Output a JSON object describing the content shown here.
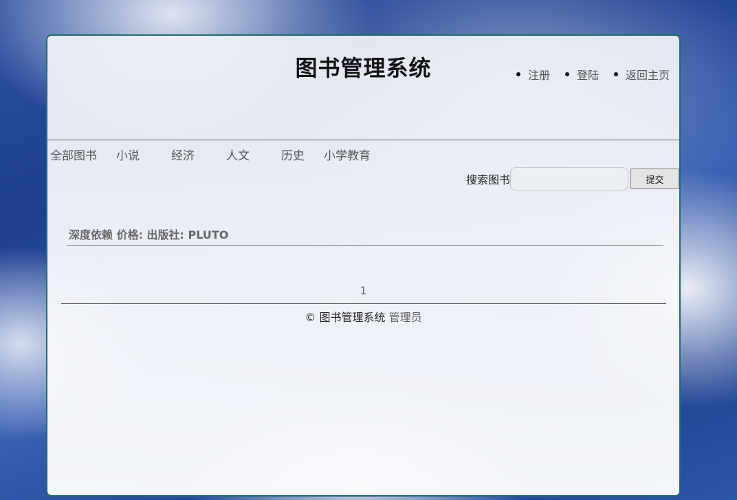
{
  "header": {
    "title": "图书管理系统",
    "nav": [
      {
        "label": "注册"
      },
      {
        "label": "登陆"
      },
      {
        "label": "返回主页"
      }
    ]
  },
  "categories": [
    {
      "label": "全部图书"
    },
    {
      "label": "小说"
    },
    {
      "label": "经济"
    },
    {
      "label": "人文"
    },
    {
      "label": "历史"
    },
    {
      "label": "小学教育"
    }
  ],
  "search": {
    "label": "搜索图书",
    "value": "",
    "submit_label": "提交"
  },
  "books": [
    {
      "text": "深度依赖 价格:  出版社: PLUTO"
    }
  ],
  "pagination": {
    "current": "1"
  },
  "footer": {
    "copyright": "© 图书管理系统",
    "admin_label": "管理员"
  },
  "colors": {
    "panel_border": "#1f6a72",
    "sky_blue": "#2b4fa0"
  }
}
